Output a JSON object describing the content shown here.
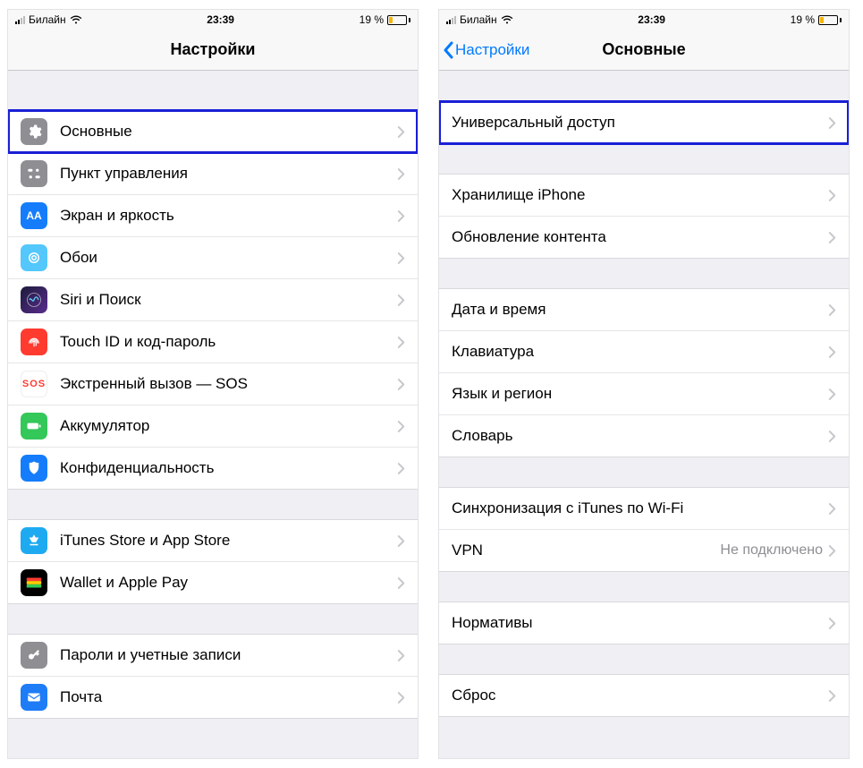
{
  "status": {
    "carrier": "Билайн",
    "time": "23:39",
    "battery_pct": "19 %"
  },
  "left": {
    "title": "Настройки",
    "groups": [
      [
        {
          "k": "general",
          "label": "Основные",
          "icon": "gear",
          "hl": true
        },
        {
          "k": "control",
          "label": "Пункт управления",
          "icon": "ctrl"
        },
        {
          "k": "display",
          "label": "Экран и яркость",
          "icon": "screen"
        },
        {
          "k": "wall",
          "label": "Обои",
          "icon": "wall"
        },
        {
          "k": "siri",
          "label": "Siri и Поиск",
          "icon": "siri"
        },
        {
          "k": "touchid",
          "label": "Touch ID и код-пароль",
          "icon": "touch"
        },
        {
          "k": "sos",
          "label": "Экстренный вызов — SOS",
          "icon": "sos"
        },
        {
          "k": "battery",
          "label": "Аккумулятор",
          "icon": "batt"
        },
        {
          "k": "privacy",
          "label": "Конфиденциальность",
          "icon": "priv"
        }
      ],
      [
        {
          "k": "store",
          "label": "iTunes Store и App Store",
          "icon": "store"
        },
        {
          "k": "wallet",
          "label": "Wallet и Apple Pay",
          "icon": "wallet"
        }
      ],
      [
        {
          "k": "pwd",
          "label": "Пароли и учетные записи",
          "icon": "key"
        },
        {
          "k": "mail",
          "label": "Почта",
          "icon": "mail"
        }
      ]
    ]
  },
  "right": {
    "back": "Настройки",
    "title": "Основные",
    "groups": [
      [
        {
          "k": "access",
          "label": "Универсальный доступ",
          "hl": true
        }
      ],
      [
        {
          "k": "storage",
          "label": "Хранилище iPhone"
        },
        {
          "k": "refresh",
          "label": "Обновление контента"
        }
      ],
      [
        {
          "k": "date",
          "label": "Дата и время"
        },
        {
          "k": "kbd",
          "label": "Клавиатура"
        },
        {
          "k": "lang",
          "label": "Язык и регион"
        },
        {
          "k": "dict",
          "label": "Словарь"
        }
      ],
      [
        {
          "k": "sync",
          "label": "Синхронизация с iTunes по Wi-Fi"
        },
        {
          "k": "vpn",
          "label": "VPN",
          "value": "Не подключено"
        }
      ],
      [
        {
          "k": "reg",
          "label": "Нормативы"
        }
      ],
      [
        {
          "k": "reset",
          "label": "Сброс"
        }
      ]
    ]
  }
}
